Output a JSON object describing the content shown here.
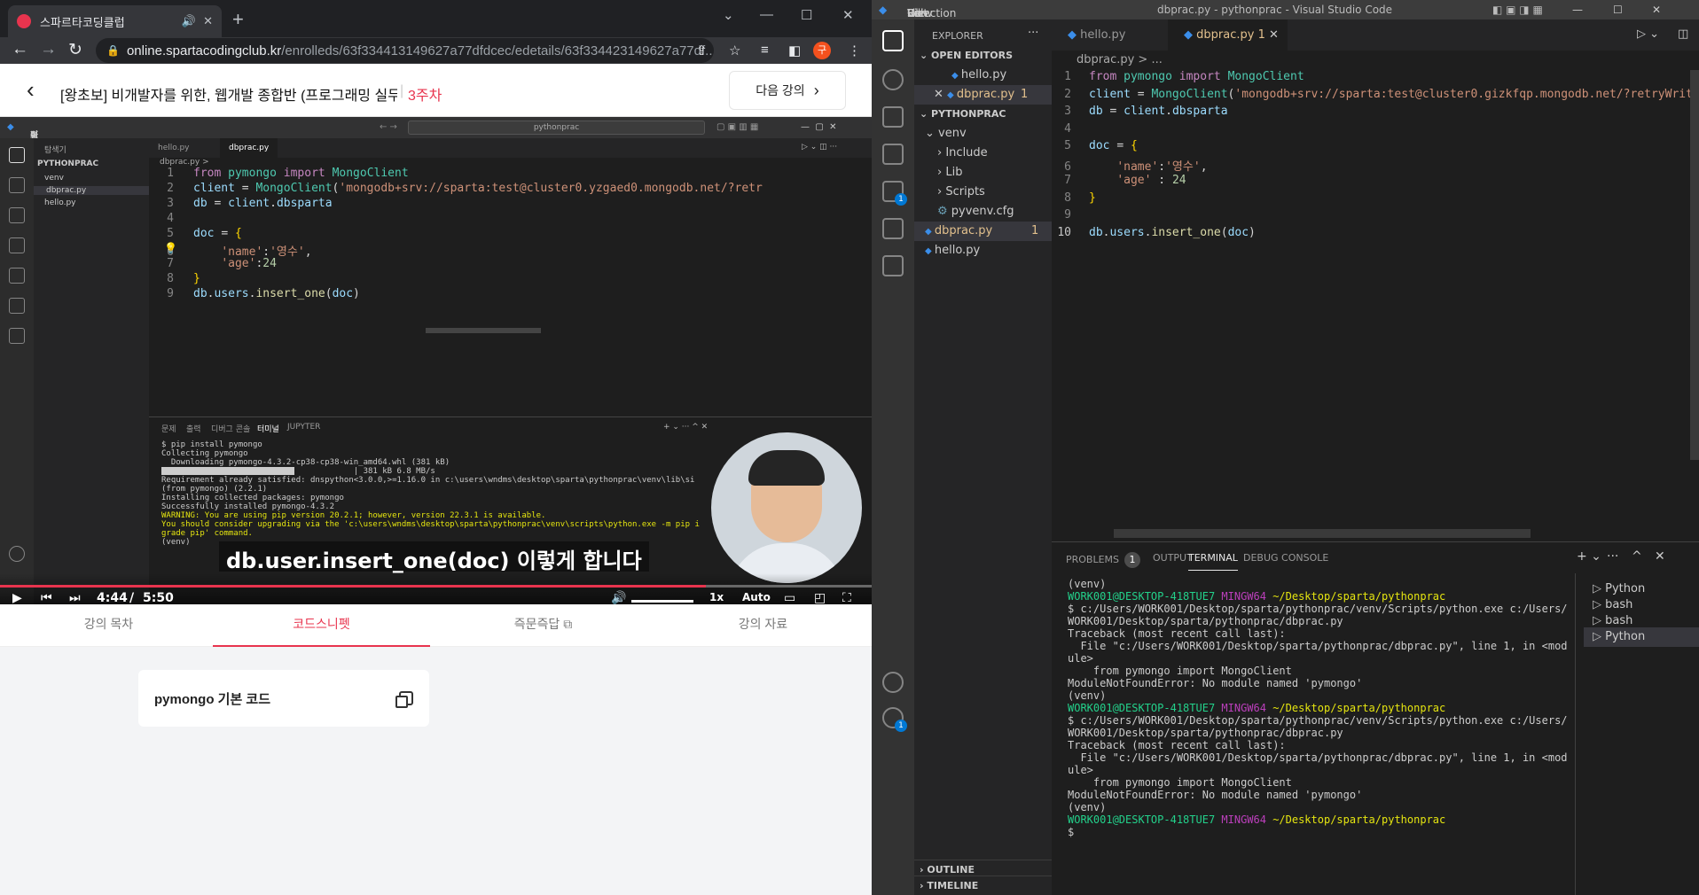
{
  "browser": {
    "tab_title": "스파르타코딩클럽",
    "url_domain": "online.spartacodingclub.kr",
    "url_path": "/enrolleds/63f334413149627a77dfdcec/edetails/63f334423149627a77df...",
    "avatar_letter": "구",
    "accent": "#e8344e"
  },
  "lecture": {
    "title": "[왕초보] 비개발자를 위한, 웹개발 종합반 (프로그래밍 실무...",
    "sep": "|",
    "week": "3주차",
    "next_label": "다음 강의",
    "tabs": [
      {
        "label": "강의 목차"
      },
      {
        "label": "코드스니펫"
      },
      {
        "label": "즉문즉답"
      },
      {
        "label": "강의 자료"
      }
    ],
    "snippet_label": "pymongo 기본 코드"
  },
  "video": {
    "subtitle": "db.user.insert_one(doc) 이렇게 합니다",
    "time_current": "4:44",
    "time_sep": "/",
    "time_total": "5:50",
    "speed": "1x",
    "quality": "Auto",
    "progress_fraction": 0.81,
    "inner_menu": [
      "파일(F)",
      "편집(E)",
      "선택 영역(S)",
      "보기(V)",
      "이동(G)",
      "실행(R)",
      "터미널(T)",
      "···"
    ],
    "inner_search": "pythonprac",
    "inner_explorer_title": "탐색기",
    "inner_project": "PYTHONPRAC",
    "inner_files": [
      "venv",
      "dbprac.py",
      "hello.py"
    ],
    "inner_tabs": [
      "hello.py",
      "dbprac.py"
    ],
    "inner_breadcrumb": "dbprac.py >",
    "inner_code": [
      {
        "n": "1",
        "p": [
          [
            "k",
            "from "
          ],
          [
            "c",
            "pymongo "
          ],
          [
            "k",
            "import "
          ],
          [
            "c",
            "MongoClient"
          ]
        ]
      },
      {
        "n": "2",
        "p": [
          [
            "v",
            "client "
          ],
          [
            "w",
            "= "
          ],
          [
            "c",
            "MongoClient"
          ],
          [
            "w",
            "("
          ],
          [
            "s",
            "'mongodb+srv://sparta:test@cluster0.yzgaed0.mongodb.net/?retr"
          ]
        ]
      },
      {
        "n": "3",
        "p": [
          [
            "v",
            "db "
          ],
          [
            "w",
            "= "
          ],
          [
            "v",
            "client"
          ],
          [
            "w",
            "."
          ],
          [
            "v",
            "dbsparta"
          ]
        ]
      },
      {
        "n": "4",
        "p": []
      },
      {
        "n": "5",
        "p": [
          [
            "v",
            "doc "
          ],
          [
            "w",
            "= "
          ],
          [
            "b",
            "{"
          ]
        ]
      },
      {
        "n": "6",
        "p": [
          [
            "w",
            "    "
          ],
          [
            "s",
            "'name'"
          ],
          [
            "w",
            ":"
          ],
          [
            "s",
            "'영수'"
          ],
          [
            "w",
            ","
          ]
        ]
      },
      {
        "n": "7",
        "p": [
          [
            "w",
            "    "
          ],
          [
            "s",
            "'age'"
          ],
          [
            "w",
            ":"
          ],
          [
            "n",
            "24"
          ]
        ]
      },
      {
        "n": "8",
        "p": [
          [
            "b",
            "}"
          ]
        ]
      },
      {
        "n": "9",
        "p": [
          [
            "v",
            "db"
          ],
          [
            "w",
            "."
          ],
          [
            "v",
            "users"
          ],
          [
            "w",
            "."
          ],
          [
            "f",
            "insert_one"
          ],
          [
            "w",
            "("
          ],
          [
            "v",
            "doc"
          ],
          [
            "w",
            ")"
          ]
        ]
      }
    ],
    "inner_panel_tabs": [
      "문제",
      "출력",
      "디버그 콘솔",
      "터미널",
      "JUPYTER"
    ],
    "inner_term": [
      {
        "t": "$ pip install pymongo",
        "c": "w"
      },
      {
        "t": "Collecting pymongo",
        "c": "w"
      },
      {
        "t": "  Downloading pymongo-4.3.2-cp38-cp38-win_amd64.whl (381 kB)",
        "c": "w"
      },
      {
        "t": "                                        | 381 kB 6.8 MB/s",
        "c": "w"
      },
      {
        "t": "Requirement already satisfied: dnspython<3.0.0,>=1.16.0 in c:\\users\\wndms\\desktop\\sparta\\pythonprac\\venv\\lib\\si",
        "c": "w"
      },
      {
        "t": "(from pymongo) (2.2.1)",
        "c": "w"
      },
      {
        "t": "Installing collected packages: pymongo",
        "c": "w"
      },
      {
        "t": "Successfully installed pymongo-4.3.2",
        "c": "w"
      },
      {
        "t": "WARNING: You are using pip version 20.2.1; however, version 22.3.1 is available.",
        "c": "y"
      },
      {
        "t": "You should consider upgrading via the 'c:\\users\\wndms\\desktop\\sparta\\pythonprac\\venv\\scripts\\python.exe -m pip i",
        "c": "y"
      },
      {
        "t": "grade pip' command.",
        "c": "y"
      },
      {
        "t": "(venv)",
        "c": "w"
      }
    ]
  },
  "vscode": {
    "menu": [
      "File",
      "Edit",
      "Selection",
      "View",
      "Go",
      "Run",
      "···"
    ],
    "window_title": "dbprac.py - pythonprac - Visual Studio Code",
    "explorer_title": "EXPLORER",
    "open_editors_label": "OPEN EDITORS",
    "open_editors": [
      {
        "name": "hello.py"
      },
      {
        "name": "dbprac.py",
        "badge": "1"
      }
    ],
    "project_label": "PYTHONPRAC",
    "tree": [
      {
        "name": "venv",
        "kind": "folder-open",
        "depth": 1
      },
      {
        "name": "Include",
        "kind": "folder",
        "depth": 2
      },
      {
        "name": "Lib",
        "kind": "folder",
        "depth": 2
      },
      {
        "name": "Scripts",
        "kind": "folder",
        "depth": 2
      },
      {
        "name": "pyvenv.cfg",
        "kind": "gear",
        "depth": 2
      },
      {
        "name": "dbprac.py",
        "kind": "py",
        "depth": 1,
        "badge": "1"
      },
      {
        "name": "hello.py",
        "kind": "py",
        "depth": 1
      }
    ],
    "outline_label": "OUTLINE",
    "timeline_label": "TIMELINE",
    "tabs": [
      {
        "name": "hello.py"
      },
      {
        "name": "dbprac.py",
        "badge": "1"
      }
    ],
    "breadcrumb": "dbprac.py > ...",
    "code": [
      {
        "n": "1",
        "p": [
          [
            "k",
            "from "
          ],
          [
            "c",
            "pymongo "
          ],
          [
            "k",
            "import "
          ],
          [
            "c",
            "MongoClient"
          ]
        ]
      },
      {
        "n": "2",
        "p": [
          [
            "v",
            "client "
          ],
          [
            "w",
            "= "
          ],
          [
            "c",
            "MongoClient"
          ],
          [
            "w",
            "("
          ],
          [
            "s",
            "'mongodb+srv://sparta:test@cluster0.gizkfqp.mongodb.net/?retryWrites=true&w=majority'"
          ]
        ]
      },
      {
        "n": "3",
        "p": [
          [
            "v",
            "db "
          ],
          [
            "w",
            "= "
          ],
          [
            "v",
            "client"
          ],
          [
            "w",
            "."
          ],
          [
            "v",
            "dbsparta"
          ]
        ]
      },
      {
        "n": "4",
        "p": []
      },
      {
        "n": "5",
        "p": [
          [
            "v",
            "doc "
          ],
          [
            "w",
            "= "
          ],
          [
            "b",
            "{"
          ]
        ]
      },
      {
        "n": "6",
        "p": [
          [
            "w",
            "    "
          ],
          [
            "s",
            "'name'"
          ],
          [
            "w",
            ":"
          ],
          [
            "s",
            "'영수'"
          ],
          [
            "w",
            ","
          ]
        ]
      },
      {
        "n": "7",
        "p": [
          [
            "w",
            "    "
          ],
          [
            "s",
            "'age'"
          ],
          [
            "w",
            " : "
          ],
          [
            "n",
            "24"
          ]
        ]
      },
      {
        "n": "8",
        "p": [
          [
            "b",
            "}"
          ]
        ]
      },
      {
        "n": "9",
        "p": []
      },
      {
        "n": "10",
        "p": [
          [
            "v",
            "db"
          ],
          [
            "w",
            "."
          ],
          [
            "v",
            "users"
          ],
          [
            "w",
            "."
          ],
          [
            "f",
            "insert_one"
          ],
          [
            "w",
            "("
          ],
          [
            "v",
            "doc"
          ],
          [
            "w",
            ")"
          ]
        ]
      }
    ],
    "panel_tabs": [
      {
        "label": "PROBLEMS",
        "count": "1"
      },
      {
        "label": "OUTPUT"
      },
      {
        "label": "TERMINAL"
      },
      {
        "label": "DEBUG CONSOLE"
      }
    ],
    "terminal": [
      [
        [
          "w",
          "(venv)"
        ]
      ],
      [
        [
          "g",
          "WORK001@DESKTOP-418TUE7 "
        ],
        [
          "p",
          "MINGW64 "
        ],
        [
          "y",
          "~/Desktop/sparta/pythonprac"
        ]
      ],
      [
        [
          "w",
          "$ c:/Users/WORK001/Desktop/sparta/pythonprac/venv/Scripts/python.exe c:/Users/"
        ]
      ],
      [
        [
          "w",
          "WORK001/Desktop/sparta/pythonprac/dbprac.py"
        ]
      ],
      [
        [
          "w",
          "Traceback (most recent call last):"
        ]
      ],
      [
        [
          "w",
          "  File \"c:/Users/WORK001/Desktop/sparta/pythonprac/dbprac.py\", line 1, in <mod"
        ]
      ],
      [
        [
          "w",
          "ule>"
        ]
      ],
      [
        [
          "w",
          "    from pymongo import MongoClient"
        ]
      ],
      [
        [
          "w",
          "ModuleNotFoundError: No module named 'pymongo'"
        ]
      ],
      [
        [
          "w",
          "(venv)"
        ]
      ],
      [
        [
          "g",
          "WORK001@DESKTOP-418TUE7 "
        ],
        [
          "p",
          "MINGW64 "
        ],
        [
          "y",
          "~/Desktop/sparta/pythonprac"
        ]
      ],
      [
        [
          "w",
          "$ c:/Users/WORK001/Desktop/sparta/pythonprac/venv/Scripts/python.exe c:/Users/"
        ]
      ],
      [
        [
          "w",
          "WORK001/Desktop/sparta/pythonprac/dbprac.py"
        ]
      ],
      [
        [
          "w",
          "Traceback (most recent call last):"
        ]
      ],
      [
        [
          "w",
          "  File \"c:/Users/WORK001/Desktop/sparta/pythonprac/dbprac.py\", line 1, in <mod"
        ]
      ],
      [
        [
          "w",
          "ule>"
        ]
      ],
      [
        [
          "w",
          "    from pymongo import MongoClient"
        ]
      ],
      [
        [
          "w",
          "ModuleNotFoundError: No module named 'pymongo'"
        ]
      ],
      [
        [
          "w",
          "(venv)"
        ]
      ],
      [
        [
          "g",
          "WORK001@DESKTOP-418TUE7 "
        ],
        [
          "p",
          "MINGW64 "
        ],
        [
          "y",
          "~/Desktop/sparta/pythonprac"
        ]
      ],
      [
        [
          "w",
          "$"
        ]
      ]
    ],
    "terminal_list": [
      {
        "name": "Python"
      },
      {
        "name": "bash"
      },
      {
        "name": "bash"
      },
      {
        "name": "Python",
        "active": true
      }
    ]
  }
}
